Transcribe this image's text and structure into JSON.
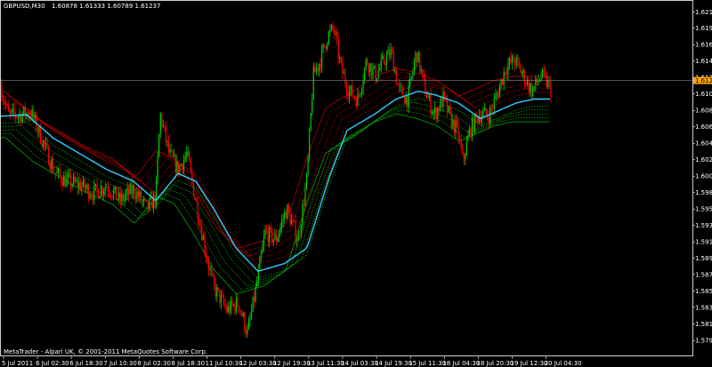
{
  "header": {
    "symbol": "GBPUSD,M30",
    "ohlc": "1.60878 1.61333 1.60789 1.61237"
  },
  "footer": {
    "copyright": "MetaTrader - Alpari UK, © 2001-2011 MetaQuotes Software Corp."
  },
  "colors": {
    "background": "#000000",
    "bull": "#00cc00",
    "bear": "#ff0000",
    "ma": "#33ccff",
    "upper_band": "#cc0000",
    "lower_band": "#00bb00",
    "axis": "#ffffff",
    "current_price_bg": "#ffa500"
  },
  "chart_data": {
    "type": "candlestick",
    "y_ticks": [
      "1.62110",
      "1.61905",
      "1.61695",
      "1.61485",
      "1.61275",
      "1.61065",
      "1.60855",
      "1.60645",
      "1.60435",
      "1.60225",
      "1.60015",
      "1.59805",
      "1.59595",
      "1.59385",
      "1.59175",
      "1.58965",
      "1.58760",
      "1.58550",
      "1.58340",
      "1.58130",
      "1.57915"
    ],
    "current_price": "1.61237",
    "x_ticks": [
      "5 Jul 2011",
      "6 Jul 02:30",
      "6 Jul 18:30",
      "7 Jul 10:30",
      "8 Jul 02:30",
      "8 Jul 18:30",
      "11 Jul 10:30",
      "12 Jul 03:30",
      "12 Jul 19:30",
      "13 Jul 11:30",
      "14 Jul 03:30",
      "14 Jul 19:30",
      "15 Jul 11:30",
      "18 Jul 04:30",
      "18 Jul 20:30",
      "19 Jul 12:30",
      "20 Jul 04:30"
    ],
    "ylim": [
      1.5777,
      1.6222
    ],
    "price_anchors": [
      [
        0,
        1.6118
      ],
      [
        10,
        1.6078
      ],
      [
        22,
        1.608
      ],
      [
        35,
        1.6082
      ],
      [
        50,
        1.604
      ],
      [
        62,
        1.6005
      ],
      [
        75,
        1.5995
      ],
      [
        90,
        1.599
      ],
      [
        105,
        1.598
      ],
      [
        120,
        1.599
      ],
      [
        135,
        1.597
      ],
      [
        150,
        1.5985
      ],
      [
        165,
        1.596
      ],
      [
        175,
        1.5975
      ],
      [
        180,
        1.608
      ],
      [
        190,
        1.603
      ],
      [
        200,
        1.601
      ],
      [
        210,
        1.603
      ],
      [
        220,
        1.597
      ],
      [
        232,
        1.59
      ],
      [
        240,
        1.586
      ],
      [
        255,
        1.583
      ],
      [
        268,
        1.584
      ],
      [
        278,
        1.58
      ],
      [
        288,
        1.586
      ],
      [
        298,
        1.593
      ],
      [
        310,
        1.592
      ],
      [
        322,
        1.596
      ],
      [
        335,
        1.592
      ],
      [
        345,
        1.6
      ],
      [
        352,
        1.613
      ],
      [
        360,
        1.615
      ],
      [
        368,
        1.618
      ],
      [
        375,
        1.619
      ],
      [
        383,
        1.614
      ],
      [
        392,
        1.611
      ],
      [
        402,
        1.61
      ],
      [
        412,
        1.615
      ],
      [
        422,
        1.613
      ],
      [
        432,
        1.615
      ],
      [
        440,
        1.616
      ],
      [
        448,
        1.611
      ],
      [
        458,
        1.61
      ],
      [
        468,
        1.616
      ],
      [
        478,
        1.611
      ],
      [
        488,
        1.608
      ],
      [
        498,
        1.61
      ],
      [
        508,
        1.607
      ],
      [
        514,
        1.606
      ],
      [
        520,
        1.602
      ],
      [
        528,
        1.606
      ],
      [
        538,
        1.608
      ],
      [
        550,
        1.608
      ],
      [
        560,
        1.611
      ],
      [
        568,
        1.614
      ],
      [
        578,
        1.615
      ],
      [
        588,
        1.613
      ],
      [
        598,
        1.611
      ],
      [
        608,
        1.613
      ],
      [
        615,
        1.612
      ],
      [
        620,
        1.611
      ]
    ],
    "ma_anchors": [
      [
        0,
        1.6078
      ],
      [
        30,
        1.608
      ],
      [
        60,
        1.605
      ],
      [
        90,
        1.603
      ],
      [
        120,
        1.601
      ],
      [
        150,
        1.5995
      ],
      [
        175,
        1.597
      ],
      [
        200,
        1.6005
      ],
      [
        220,
        1.5995
      ],
      [
        240,
        1.596
      ],
      [
        265,
        1.591
      ],
      [
        290,
        1.588
      ],
      [
        320,
        1.589
      ],
      [
        345,
        1.591
      ],
      [
        370,
        1.6
      ],
      [
        390,
        1.606
      ],
      [
        420,
        1.608
      ],
      [
        445,
        1.61
      ],
      [
        470,
        1.611
      ],
      [
        490,
        1.6105
      ],
      [
        515,
        1.6095
      ],
      [
        540,
        1.6075
      ],
      [
        560,
        1.6085
      ],
      [
        580,
        1.6095
      ],
      [
        600,
        1.61
      ],
      [
        618,
        1.61
      ]
    ],
    "band_offsets": [
      0.0009,
      0.0014,
      0.0019,
      0.0024,
      0.0029
    ]
  }
}
